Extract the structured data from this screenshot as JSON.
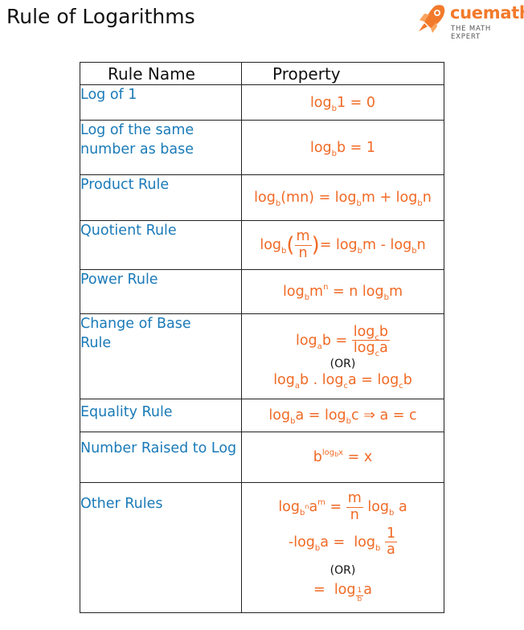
{
  "header": {
    "title": "Rule of Logarithms",
    "logo_brand": "cuemath",
    "logo_tagline": "THE MATH EXPERT"
  },
  "colors": {
    "rule_name": "#1a7ab8",
    "property": "#f06a25",
    "brand": "#f27a2b",
    "border": "#222222"
  },
  "table": {
    "headers": [
      "Rule Name",
      "Property"
    ],
    "rows": [
      {
        "name": "Log of 1",
        "property": "log_b 1 = 0"
      },
      {
        "name": "Log of the same number as base",
        "property": "log_b b = 1"
      },
      {
        "name": "Product Rule",
        "property": "log_b(mn) = log_b m + log_b n"
      },
      {
        "name": "Quotient Rule",
        "property": "log_b(m/n) = log_b m - log_b n"
      },
      {
        "name": "Power Rule",
        "property": "log_b m^n = n log_b m"
      },
      {
        "name": "Change of Base Rule",
        "property": "log_a b = log_c b / log_c a (OR) log_a b . log_c a = log_c b"
      },
      {
        "name": "Equality Rule",
        "property": "log_b a = log_b c ⇒ a = c"
      },
      {
        "name": "Number Raised to Log",
        "property": "b^(log_b x) = x"
      },
      {
        "name": "Other Rules",
        "property": "log_(b^n) a^m = (m/n) log_b a ; -log_b a = log_b (1/a) (OR) = log_(1/b) a"
      }
    ]
  }
}
